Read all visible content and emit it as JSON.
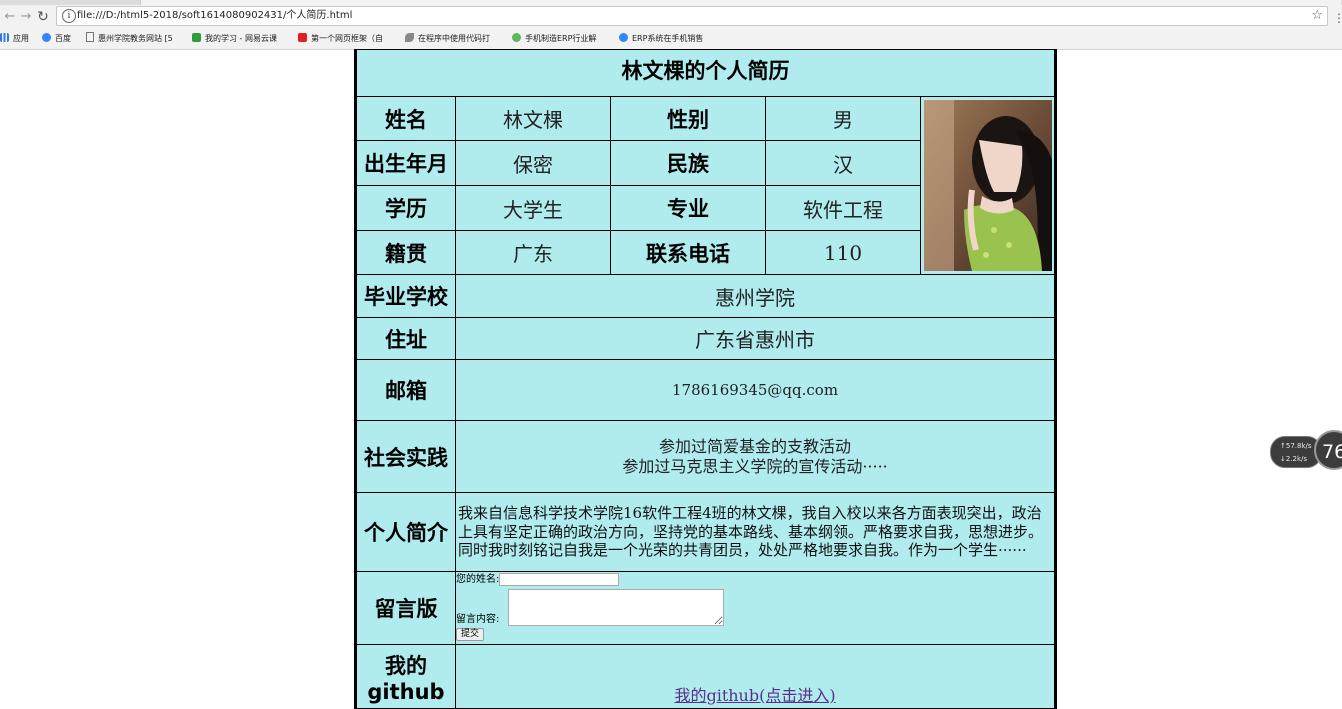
{
  "browser": {
    "url": "file:///D:/html5-2018/soft1614080902431/个人简历.html",
    "bookmarks": [
      {
        "label": "应用",
        "icon": "apps-grid-icon",
        "color": "#2d7be0"
      },
      {
        "label": "百度",
        "icon": "baidu-paw-icon",
        "color": "#3385ff"
      },
      {
        "label": "惠州学院教务网站 [5",
        "icon": "page-icon",
        "color": "#777777"
      },
      {
        "label": "我的学习 - 网易云课",
        "icon": "netease-icon",
        "color": "#2e9e3a"
      },
      {
        "label": "第一个网页框架（自",
        "icon": "c-logo-icon",
        "color": "#e02020"
      },
      {
        "label": "在程序中使用代码打",
        "icon": "feather-icon",
        "color": "#666666"
      },
      {
        "label": "手机制造ERP行业解",
        "icon": "leaf-icon",
        "color": "#5cb85c"
      },
      {
        "label": "ERP系统在手机销售",
        "icon": "baidu-paw-icon",
        "color": "#3385ff"
      }
    ]
  },
  "resume": {
    "title": "林文棵的个人简历",
    "labels": {
      "name": "姓名",
      "gender": "性别",
      "birth": "出生年月",
      "ethnicity": "民族",
      "education": "学历",
      "major": "专业",
      "hometown": "籍贯",
      "phone": "联系电话",
      "school": "毕业学校",
      "address": "住址",
      "email": "邮箱",
      "practice": "社会实践",
      "intro": "个人简介",
      "message": "留言版",
      "github_line1": "我的",
      "github_line2": "github"
    },
    "values": {
      "name": "林文棵",
      "gender": "男",
      "birth": "保密",
      "ethnicity": "汉",
      "education": "大学生",
      "major": "软件工程",
      "hometown": "广东",
      "phone": "110",
      "school": "惠州学院",
      "address": "广东省惠州市",
      "email": "1786169345@qq.com",
      "practice_line1": "参加过简爱基金的支教活动",
      "practice_line2": "参加过马克思主义学院的宣传活动·····",
      "intro": "我来自信息科学技术学院16软件工程4班的林文棵，我自入校以来各方面表现突出，政治上具有坚定正确的政治方向，坚持党的基本路线、基本纲领。严格要求自我，思想进步。同时我时刻铭记自我是一个光荣的共青团员，处处严格地要求自我。作为一个学生······"
    },
    "message_form": {
      "name_label": "您的姓名:",
      "name_value": "",
      "content_label": "留言内容:",
      "content_value": "",
      "submit_label": "提交"
    },
    "github_link": "我的github(点击进入)"
  },
  "speed_widget": {
    "up": "↑57.8k/s",
    "down": "↓2.2k/s",
    "percent": "76"
  }
}
